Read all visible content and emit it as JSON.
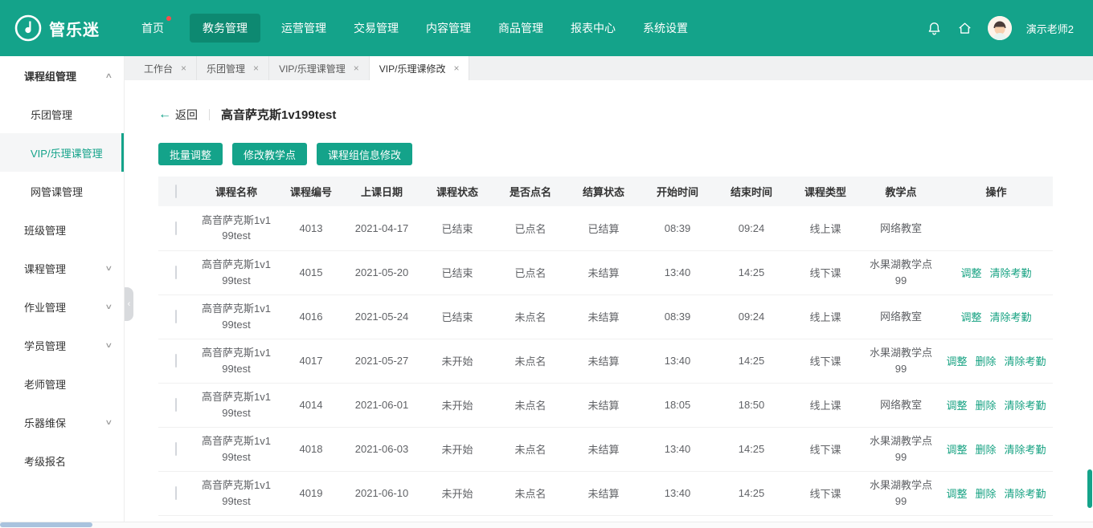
{
  "colors": {
    "primary": "#14a38a",
    "primary_dark": "#0d8971",
    "link": "#16a282",
    "badge": "#ff4b4b",
    "table_header_bg": "#f5f6f7"
  },
  "icons": {
    "back_arrow": "←",
    "close": "×",
    "chevron_up": "∧",
    "chevron_down": "∨",
    "collapse_left": "‹",
    "logo": "music-note-circle",
    "bell": "bell",
    "home": "home"
  },
  "header": {
    "logo_text": "管乐迷",
    "nav": [
      {
        "label": "首页",
        "badge": true
      },
      {
        "label": "教务管理",
        "active": true
      },
      {
        "label": "运营管理"
      },
      {
        "label": "交易管理"
      },
      {
        "label": "内容管理"
      },
      {
        "label": "商品管理"
      },
      {
        "label": "报表中心"
      },
      {
        "label": "系统设置"
      }
    ],
    "user_name": "演示老师2"
  },
  "sidebar": {
    "items": [
      {
        "label": "课程组管理",
        "group": true,
        "chevron": "up"
      },
      {
        "label": "乐团管理",
        "sub": true
      },
      {
        "label": "VIP/乐理课管理",
        "sub": true,
        "active": true
      },
      {
        "label": "网管课管理",
        "sub": true
      },
      {
        "label": "班级管理"
      },
      {
        "label": "课程管理",
        "chevron": "down"
      },
      {
        "label": "作业管理",
        "chevron": "down"
      },
      {
        "label": "学员管理",
        "chevron": "down"
      },
      {
        "label": "老师管理"
      },
      {
        "label": "乐器维保",
        "chevron": "down"
      },
      {
        "label": "考级报名"
      }
    ]
  },
  "tabs": [
    {
      "label": "工作台"
    },
    {
      "label": "乐团管理"
    },
    {
      "label": "VIP/乐理课管理"
    },
    {
      "label": "VIP/乐理课修改",
      "active": true
    }
  ],
  "page": {
    "back_label": "返回",
    "title": "高音萨克斯1v199test",
    "buttons": [
      "批量调整",
      "修改教学点",
      "课程组信息修改"
    ]
  },
  "table": {
    "headers": [
      "课程名称",
      "课程编号",
      "上课日期",
      "课程状态",
      "是否点名",
      "结算状态",
      "开始时间",
      "结束时间",
      "课程类型",
      "教学点",
      "操作"
    ],
    "rows": [
      {
        "name": "高音萨克斯1v199test",
        "code": "4013",
        "date": "2021-04-17",
        "status": "已结束",
        "rollcall": "已点名",
        "settle": "已结算",
        "start": "08:39",
        "end": "09:24",
        "type": "线上课",
        "location": "网络教室",
        "actions": []
      },
      {
        "name": "高音萨克斯1v199test",
        "code": "4015",
        "date": "2021-05-20",
        "status": "已结束",
        "rollcall": "已点名",
        "settle": "未结算",
        "start": "13:40",
        "end": "14:25",
        "type": "线下课",
        "location": "水果湖教学点99",
        "actions": [
          "调整",
          "清除考勤"
        ]
      },
      {
        "name": "高音萨克斯1v199test",
        "code": "4016",
        "date": "2021-05-24",
        "status": "已结束",
        "rollcall": "未点名",
        "settle": "未结算",
        "start": "08:39",
        "end": "09:24",
        "type": "线上课",
        "location": "网络教室",
        "actions": [
          "调整",
          "清除考勤"
        ]
      },
      {
        "name": "高音萨克斯1v199test",
        "code": "4017",
        "date": "2021-05-27",
        "status": "未开始",
        "rollcall": "未点名",
        "settle": "未结算",
        "start": "13:40",
        "end": "14:25",
        "type": "线下课",
        "location": "水果湖教学点99",
        "actions": [
          "调整",
          "删除",
          "清除考勤"
        ]
      },
      {
        "name": "高音萨克斯1v199test",
        "code": "4014",
        "date": "2021-06-01",
        "status": "未开始",
        "rollcall": "未点名",
        "settle": "未结算",
        "start": "18:05",
        "end": "18:50",
        "type": "线上课",
        "location": "网络教室",
        "actions": [
          "调整",
          "删除",
          "清除考勤"
        ]
      },
      {
        "name": "高音萨克斯1v199test",
        "code": "4018",
        "date": "2021-06-03",
        "status": "未开始",
        "rollcall": "未点名",
        "settle": "未结算",
        "start": "13:40",
        "end": "14:25",
        "type": "线下课",
        "location": "水果湖教学点99",
        "actions": [
          "调整",
          "删除",
          "清除考勤"
        ]
      },
      {
        "name": "高音萨克斯1v199test",
        "code": "4019",
        "date": "2021-06-10",
        "status": "未开始",
        "rollcall": "未点名",
        "settle": "未结算",
        "start": "13:40",
        "end": "14:25",
        "type": "线下课",
        "location": "水果湖教学点99",
        "actions": [
          "调整",
          "删除",
          "清除考勤"
        ]
      }
    ]
  }
}
